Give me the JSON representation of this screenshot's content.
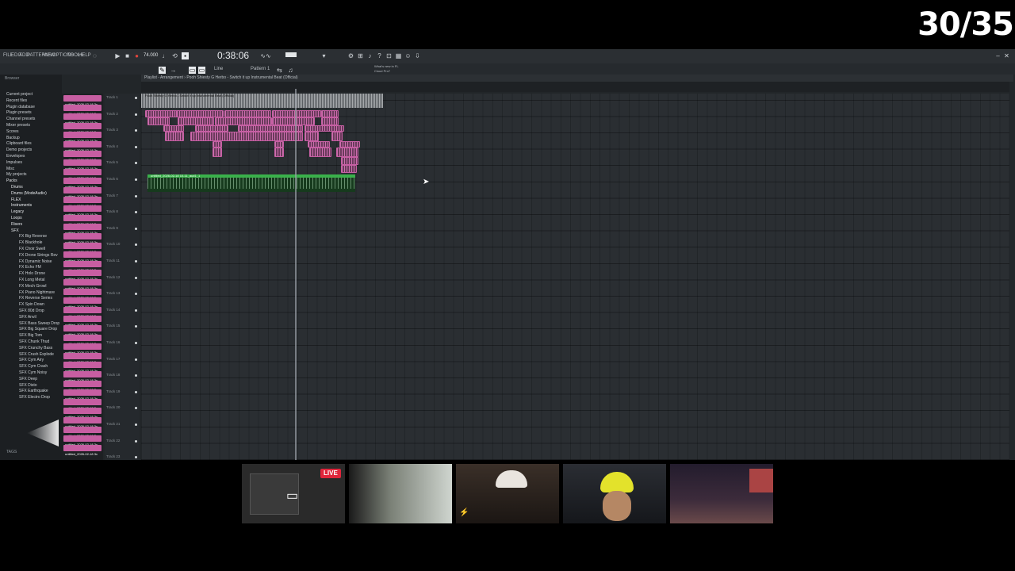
{
  "overlay": {
    "counter": "30/35"
  },
  "menu": [
    "FILE",
    "EDIT",
    "ADD",
    "PATTERNS",
    "VIEW",
    "OPTIONS",
    "TOOLS",
    "HELP"
  ],
  "transport": {
    "time": "0:38:06",
    "tempo": "74.000",
    "pattern": "Pattern 1",
    "mode": "Line"
  },
  "news": {
    "line1": "What's new in FL",
    "line2": "Cloud Pro?"
  },
  "playlist": {
    "title": "Playlist - Arrangement › Pooh Shiesty G Herbo - Switch it up Instrumental Beat (Official)"
  },
  "browser": {
    "header": "Browser",
    "items": [
      "Current project",
      "Recent files",
      "Plugin database",
      "Plugin presets",
      "Channel presets",
      "Mixer presets",
      "Scores",
      "Backup",
      "Clipboard files",
      "Demo projects",
      "Envelopes",
      "Impulses",
      "Misc",
      "My projects",
      "Packs",
      "Drums",
      "Drums (ModeAudio)",
      "FLEX",
      "Instruments",
      "Legacy",
      "Loops",
      "Risers",
      "SFX",
      "FX Big Reverse",
      "FX Blackhole",
      "FX Choir Swell",
      "FX Drone Strings Rev",
      "FX Dynamic Noise",
      "FX Echo FM",
      "FX Holo Drone",
      "FX Long Metal",
      "FX Mech Growl",
      "FX Piano Nightmare",
      "FX Reverse Series",
      "FX Spin Down",
      "SFX 80d Drop",
      "SFX Anvil",
      "SFX Bass Sweep Drop",
      "SFX Big Square Drop",
      "SFX Big Tom",
      "SFX Chunk Thud",
      "SFX Crunchy Bass",
      "SFX Crush Explode",
      "SFX Cym Airy",
      "SFX Cym Crash",
      "SFX Cym Noisy",
      "SFX Deep",
      "SFX Disto",
      "SFX Earthquake",
      "SFX Electro Drop"
    ],
    "tags": "TAGS"
  },
  "patterns": [
    "untitled_2026-02-18 3x",
    "untitled_2026-02-18 3x",
    "untitled_2026-02-18 3x",
    "untitled_2026-02-18 3x",
    "untitled_2026-02-18 3x",
    "untitled_2026-02-18 3x",
    "untitled_2026-02-18 3x",
    "untitled_2026-02-18 3x",
    "untitled_2026-02-18 3x",
    "untitled_2026-02-18 3x",
    "untitled_2026-02-18 3x",
    "untitled_2026-02-18 3x",
    "untitled_2026-02-18 3x",
    "untitled_2026-02-18 3x",
    "untitled_2026-02-18 3x",
    "untitled_2026-02-18 3x",
    "untitled_2026-02-18 3x",
    "untitled_2026-02-18 3x",
    "untitled_2026-02-18 3x",
    "untitled_2026-02-18 3x",
    "untitled_2026-02-18 3x",
    "untitled_2026-02-18 3x",
    "untitled_2026-02-18 3x",
    "untitled_2026-02-18 3x",
    "untitled_2026-02-18 3x",
    "untitled_2026-02-18 3x",
    "untitled_2026-02-18 3x",
    "untitled_2026-02-18 3x",
    "untitled_2026-02-18 3x",
    "untitled_2026-02-18 3x",
    "untitled_2026-02-18 3x",
    "untitled_2026-02-18 3x",
    "untitled_2026-02-18 3x",
    "untitled_2026-02-18 3x",
    "untitled_2026-02-18 3x",
    "untitled_2026-02-18 3x",
    "untitled_2026-02-18 3x",
    "untitled_2026-02-18 3x",
    "untitled_2026-02-18 3x"
  ],
  "tracks": [
    "Track 1",
    "Track 2",
    "Track 3",
    "Track 4",
    "Track 5",
    "Track 6",
    "Track 7",
    "Track 8",
    "Track 9",
    "Track 10",
    "Track 11",
    "Track 12",
    "Track 13",
    "Track 14",
    "Track 15",
    "Track 16",
    "Track 17",
    "Track 18",
    "Track 19",
    "Track 20",
    "Track 21",
    "Track 22",
    "Track 23"
  ],
  "clips": {
    "audio_top": "Pooh Shiesty G Herbo - Switch it up Instrumental Beat (Official)",
    "green": "untitled_2026-02-18 10-11_aud1_1"
  },
  "stream": {
    "live": "LIVE"
  },
  "colors": {
    "pattern_clip": "#c75ea2",
    "audio_clip": "#3ab14b",
    "live": "#e0253b"
  }
}
